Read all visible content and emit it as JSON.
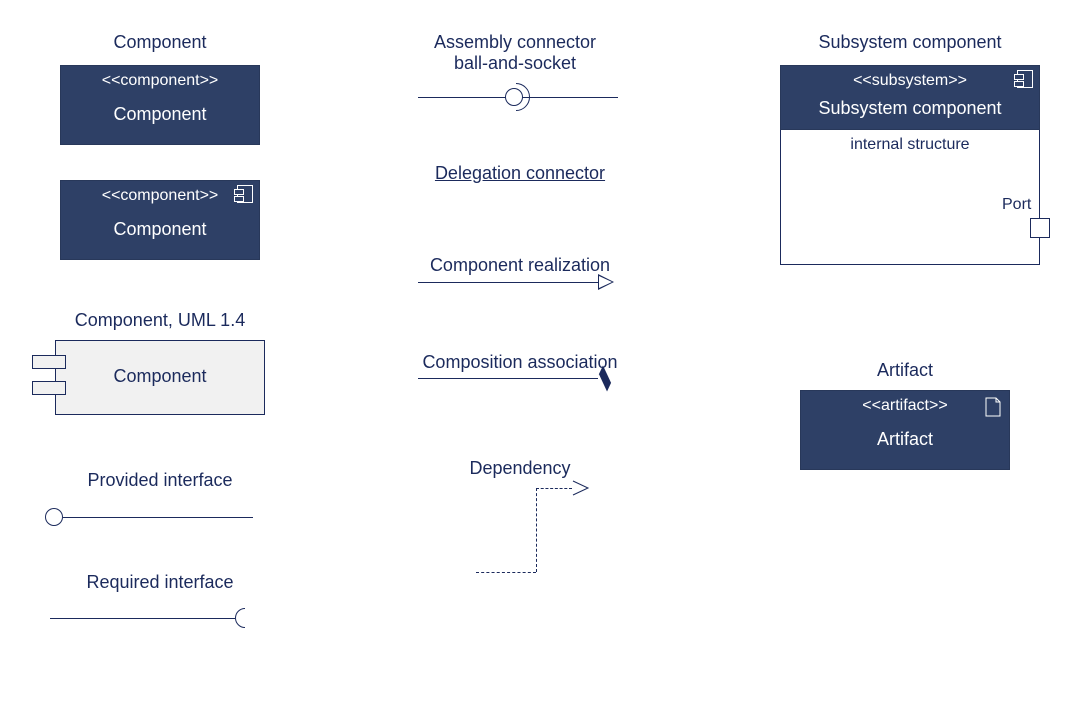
{
  "col1": {
    "component_title": "Component",
    "box1": {
      "stereo": "<<component>>",
      "name": "Component"
    },
    "box2": {
      "stereo": "<<component>>",
      "name": "Component"
    },
    "uml14_title": "Component, UML 1.4",
    "uml14_name": "Component",
    "provided_title": "Provided interface",
    "required_title": "Required interface"
  },
  "col2": {
    "assembly_title_l1": "Assembly connector",
    "assembly_title_l2": "ball-and-socket",
    "delegation_title": "Delegation connector",
    "realization_title": "Component realization",
    "composition_title": "Composition association",
    "dependency_title": "Dependency"
  },
  "col3": {
    "subsystem_title": "Subsystem component",
    "subsys_stereo": "<<subsystem>>",
    "subsys_name": "Subsystem component",
    "subsys_body": "internal structure",
    "port_label": "Port",
    "artifact_title": "Artifact",
    "artifact_stereo": "<<artifact>>",
    "artifact_name": "Artifact"
  }
}
